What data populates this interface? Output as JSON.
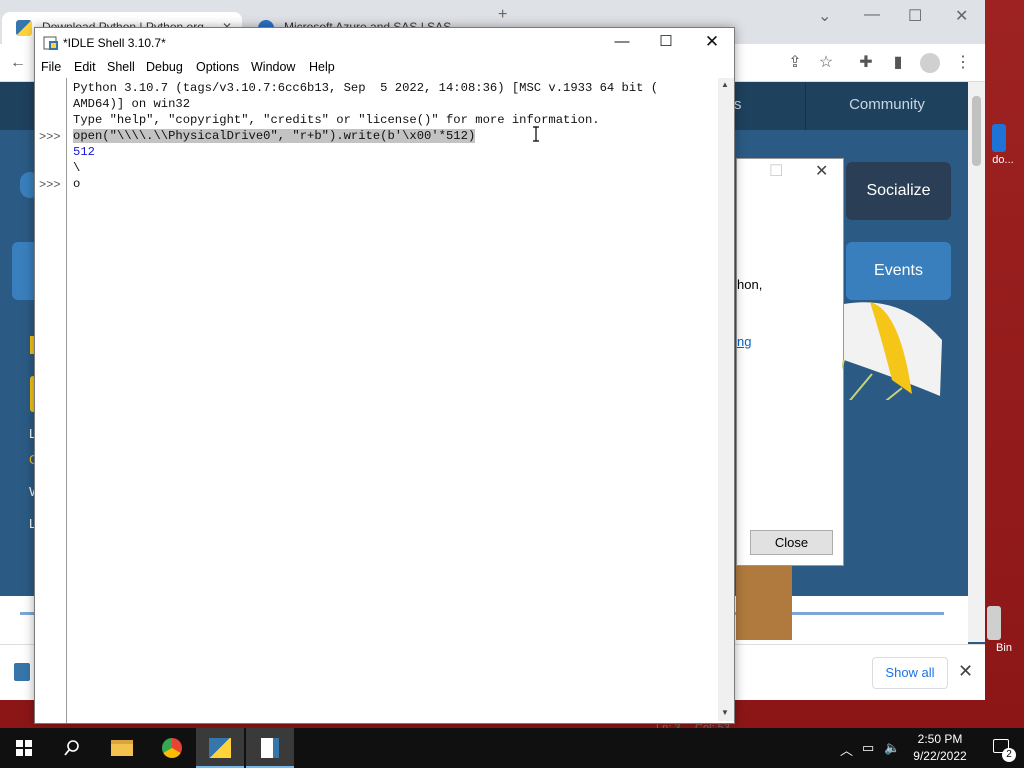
{
  "browser": {
    "tabs": [
      {
        "label": "Download Python | Python.org"
      },
      {
        "label": "Microsoft Azure and SAS | SAS"
      }
    ],
    "nav": {
      "menu_fragment": "s",
      "community": "Community",
      "socialize": "Socialize",
      "events": "Events"
    },
    "side_fragments": {
      "f1": "L",
      "f2": "G",
      "f3": "W",
      "f4": "L"
    },
    "download_bar": {
      "show_all": "Show all"
    }
  },
  "installer": {
    "text_fragment": "hon,",
    "link_fragment": "ng",
    "close_button": "Close"
  },
  "desktop": {
    "icon1_label": "do...",
    "recycle_label": "Bin"
  },
  "idle": {
    "title": "*IDLE Shell 3.10.7*",
    "menu": [
      "File",
      "Edit",
      "Shell",
      "Debug",
      "Options",
      "Window",
      "Help"
    ],
    "prompt": ">>>",
    "lines": [
      "Python 3.10.7 (tags/v3.10.7:6cc6b13, Sep  5 2022, 14:08:36) [MSC v.1933 64 bit (",
      "AMD64)] on win32",
      "Type \"help\", \"copyright\", \"credits\" or \"license()\" for more information.",
      "open(\"\\\\\\\\.\\\\PhysicalDrive0\", \"r+b\").write(b'\\x00'*512)",
      "512",
      "\\",
      "o"
    ],
    "status": {
      "ln": "Ln: 3",
      "col": "Col: 53"
    }
  },
  "taskbar": {
    "time": "2:50 PM",
    "date": "9/22/2022",
    "notification_count": "2"
  }
}
